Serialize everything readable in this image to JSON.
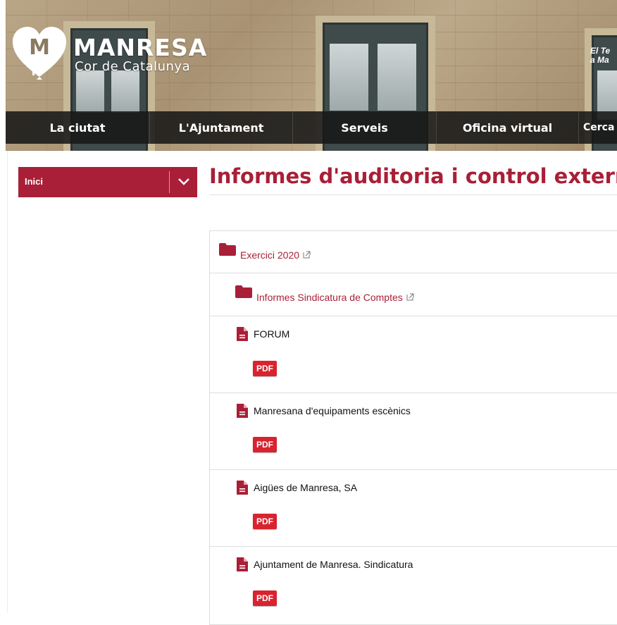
{
  "header": {
    "logo_letter": "M",
    "logo_title": "MANRESA",
    "logo_subtitle": "Cor de Catalunya",
    "teaser_line1": "El Te",
    "teaser_line2": "a Ma"
  },
  "nav": {
    "items": [
      {
        "label": "La ciutat"
      },
      {
        "label": "L'Ajuntament"
      },
      {
        "label": "Serveis"
      },
      {
        "label": "Oficina virtual"
      },
      {
        "label": "Cerca"
      }
    ]
  },
  "sidebar": {
    "inici_label": "Inici"
  },
  "main": {
    "title": "Informes d'auditoria i control extern",
    "folders": [
      {
        "label": "Exercici 2020"
      },
      {
        "label": "Informes Sindicatura de Comptes"
      }
    ],
    "files": [
      {
        "name": "FORUM",
        "button": "PDF"
      },
      {
        "name": "Manresana d'equipaments escènics",
        "button": "PDF"
      },
      {
        "name": "Aigües de Manresa, SA",
        "button": "PDF"
      },
      {
        "name": "Ajuntament de Manresa. Sindicatura",
        "button": "PDF"
      }
    ]
  },
  "colors": {
    "brand_red": "#a91f37",
    "pdf_red": "#d9232f",
    "nav_bg": "#181818"
  },
  "icons": [
    "heart-logo-icon",
    "chevron-down-icon",
    "folder-icon",
    "external-link-icon",
    "file-icon"
  ]
}
